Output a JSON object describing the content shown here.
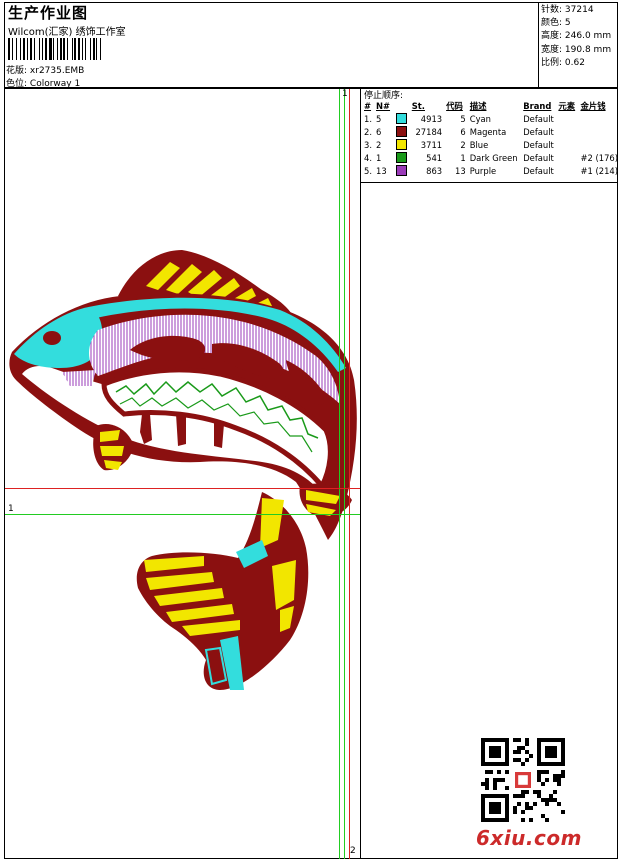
{
  "header": {
    "title": "生产作业图",
    "company": "Wilcom(汇家) 绣饰工作室",
    "design_label": "花版:",
    "design_value": "xr2735.EMB",
    "colorway_label": "色位:",
    "colorway_value": "Colorway 1"
  },
  "stats": [
    {
      "label": "针数:",
      "value": "37214"
    },
    {
      "label": "颜色:",
      "value": "5"
    },
    {
      "label": "高度:",
      "value": "246.0 mm"
    },
    {
      "label": "宽度:",
      "value": "190.8 mm"
    },
    {
      "label": "比例:",
      "value": "0.62"
    }
  ],
  "stop_sequence": {
    "title": "停止顺序:",
    "headers": [
      "#",
      "N#",
      "St.",
      "代码",
      "描述",
      "Brand",
      "元素",
      "金片钱"
    ],
    "rows": [
      {
        "idx": "1.",
        "n": "5",
        "color": "#33dddd",
        "st": "4913",
        "code": "5",
        "desc": "Cyan",
        "brand": "Default",
        "element": "",
        "sequin": ""
      },
      {
        "idx": "2.",
        "n": "6",
        "color": "#8b1010",
        "st": "27184",
        "code": "6",
        "desc": "Magenta",
        "brand": "Default",
        "element": "",
        "sequin": ""
      },
      {
        "idx": "3.",
        "n": "2",
        "color": "#f2e600",
        "st": "3711",
        "code": "2",
        "desc": "Blue",
        "brand": "Default",
        "element": "",
        "sequin": ""
      },
      {
        "idx": "4.",
        "n": "1",
        "color": "#1a9a1a",
        "st": "541",
        "code": "1",
        "desc": "Dark Green",
        "brand": "Default",
        "element": "",
        "sequin": "#2 (176)"
      },
      {
        "idx": "5.",
        "n": "13",
        "color": "#9a3bb8",
        "st": "863",
        "code": "13",
        "desc": "Purple",
        "brand": "Default",
        "element": "",
        "sequin": "#1 (214)"
      }
    ]
  },
  "guides": {
    "v1": "1",
    "v2": "2",
    "h1": "1"
  },
  "watermark": {
    "text": "6xiu.com"
  },
  "colors": {
    "cyan": "#33dddd",
    "maroon": "#8b1010",
    "yellow": "#f2e600",
    "green": "#1a9a1a",
    "purple": "#9a3bb8",
    "guide_green": "#22cc22",
    "guide_red": "#dd2222"
  }
}
